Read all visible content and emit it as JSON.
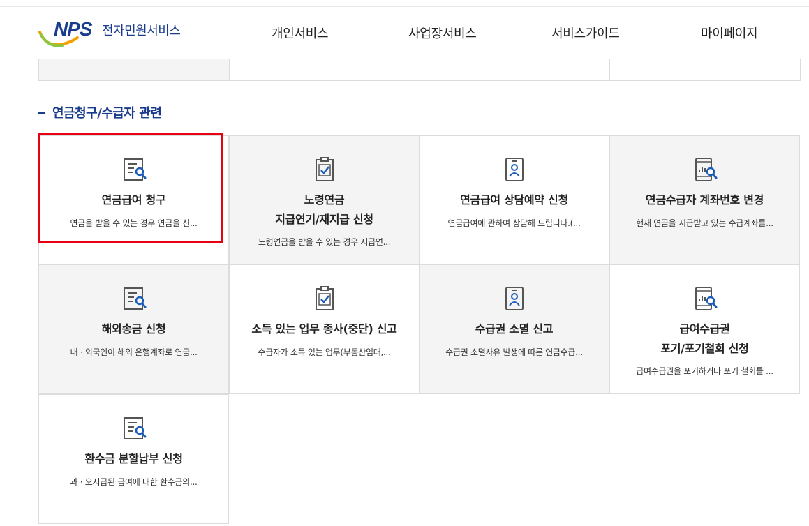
{
  "header": {
    "logo_text": "NPS",
    "service_name": "전자민원서비스",
    "nav": [
      "개인서비스",
      "사업장서비스",
      "서비스가이드",
      "마이페이지"
    ]
  },
  "section": {
    "title": "연금청구/수급자 관련"
  },
  "cards": [
    {
      "title": "연금급여 청구",
      "desc": "연금을 받을 수 있는 경우 연금을 신...",
      "icon": "document-search-icon"
    },
    {
      "title_line1": "노령연금",
      "title_line2": "지급연기/재지급 신청",
      "desc": "노령연금을 받을 수 있는 경우 지급연...",
      "icon": "clipboard-check-icon"
    },
    {
      "title": "연금급여 상담예약 신청",
      "desc": "연금급여에 관하여 상담해 드립니다.(...",
      "icon": "id-badge-icon"
    },
    {
      "title": "연금수급자 계좌번호 변경",
      "desc": "현재 연금을 지급받고 있는 수급계좌를...",
      "icon": "mobile-chart-search-icon"
    },
    {
      "title": "해외송금 신청",
      "desc": "내 · 외국인이 해외 은행계좌로 연금...",
      "icon": "document-search-icon"
    },
    {
      "title": "소득 있는 업무 종사(중단) 신고",
      "desc": "수급자가 소득 있는 업무(부동산임대,...",
      "icon": "clipboard-check-icon"
    },
    {
      "title": "수급권 소멸 신고",
      "desc": "수급권 소멸사유 발생에 따른 연금수급...",
      "icon": "id-badge-icon"
    },
    {
      "title_line1": "급여수급권",
      "title_line2": "포기/포기철회 신청",
      "desc": "급여수급권을 포기하거나 포기 철회를 ...",
      "icon": "mobile-chart-search-icon"
    },
    {
      "title": "환수금 분할납부 신청",
      "desc": "과 · 오지급된 급여에 대한 환수금의...",
      "icon": "document-search-icon"
    }
  ]
}
